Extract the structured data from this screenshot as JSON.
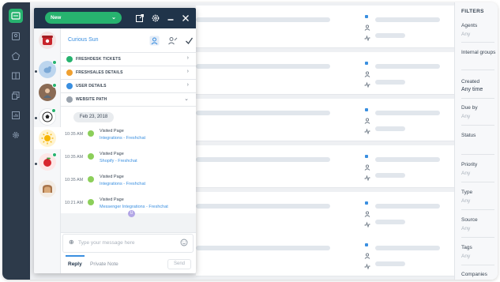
{
  "widget": {
    "status": "New",
    "contact_name": "Curious Sun",
    "sections": [
      {
        "label": "FRESHDESK TICKETS",
        "color": "#27b36f",
        "chevron": "›"
      },
      {
        "label": "FRESHSALES DETAILS",
        "color": "#f0a030",
        "chevron": "›"
      },
      {
        "label": "USER DETAILS",
        "color": "#3a8fe0",
        "chevron": "›"
      },
      {
        "label": "WEBSITE PATH",
        "color": "#9aa3ad",
        "chevron": "⌄"
      }
    ],
    "date": "Feb 23, 2018",
    "events": [
      {
        "time": "10:35 AM",
        "title": "Visited Page",
        "link": "Integrations - Freshchat"
      },
      {
        "time": "10:35 AM",
        "title": "Visited Page",
        "link": "Shopify - Freshchat"
      },
      {
        "time": "10:35 AM",
        "title": "Visited Page",
        "link": "Integrations - Freshchat"
      },
      {
        "time": "10:21 AM",
        "title": "Visited Page",
        "link": "Messenger Integrations - Freshchat"
      }
    ],
    "unread_badge": "U",
    "composer_placeholder": "Type your message here",
    "reply_tab": "Reply",
    "private_note_tab": "Private Note",
    "send_label": "Send"
  },
  "filters": {
    "title": "FILTERS",
    "items": [
      {
        "label": "Agents",
        "value": "Any"
      },
      {
        "label": "Internal groups",
        "value": ""
      },
      {
        "label": "Created",
        "value": "Any time"
      },
      {
        "label": "Due by",
        "value": "Any"
      },
      {
        "label": "Status",
        "value": ""
      },
      {
        "label": "Priority",
        "value": "Any"
      },
      {
        "label": "Type",
        "value": "Any"
      },
      {
        "label": "Source",
        "value": "Any"
      },
      {
        "label": "Tags",
        "value": "Any"
      },
      {
        "label": "Companies",
        "value": ""
      }
    ]
  },
  "colors": {
    "nav_bg": "#2d3a4a",
    "header_bg": "#20344a",
    "accent_green": "#27b36f",
    "link_blue": "#3a8fe0"
  }
}
